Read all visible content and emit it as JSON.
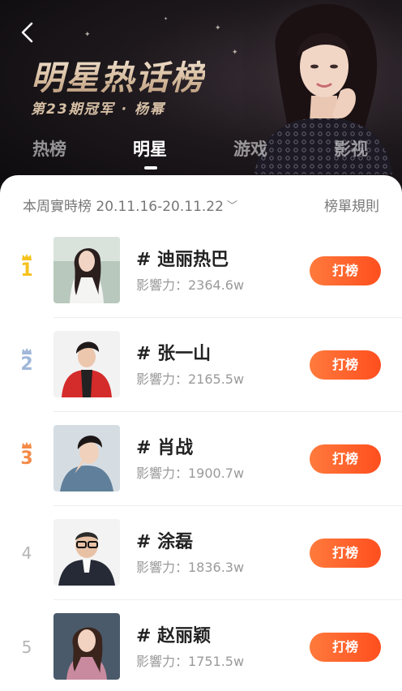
{
  "header": {
    "title": "明星热话榜",
    "subtitle": "第23期冠军 · 杨幂",
    "tabs": [
      {
        "label": "热榜",
        "active": false
      },
      {
        "label": "明星",
        "active": true
      },
      {
        "label": "游戏",
        "active": false
      },
      {
        "label": "影视",
        "active": false
      }
    ]
  },
  "toolbar": {
    "period_label": "本周實時榜 20.11.16-20.11.22",
    "rules_label": "榜單規則"
  },
  "ranking": [
    {
      "rank": "1",
      "name": "# 迪丽热巴",
      "influence": "影響力：2364.6w",
      "vote_label": "打榜",
      "color": "#f6c21c",
      "crown": true
    },
    {
      "rank": "2",
      "name": "# 张一山",
      "influence": "影響力：2165.5w",
      "vote_label": "打榜",
      "color": "#9fb7da",
      "crown": true
    },
    {
      "rank": "3",
      "name": "# 肖战",
      "influence": "影響力：1900.7w",
      "vote_label": "打榜",
      "color": "#f48a47",
      "crown": true
    },
    {
      "rank": "4",
      "name": "# 涂磊",
      "influence": "影響力：1836.3w",
      "vote_label": "打榜",
      "color": "#b5b5b5",
      "crown": false
    },
    {
      "rank": "5",
      "name": "# 赵丽颖",
      "influence": "影響力：1751.5w",
      "vote_label": "打榜",
      "color": "#b5b5b5",
      "crown": false
    }
  ],
  "colors": {
    "accent": "#ff5a23",
    "gold": "#f6c21c",
    "silver": "#9fb7da",
    "bronze": "#f48a47"
  }
}
